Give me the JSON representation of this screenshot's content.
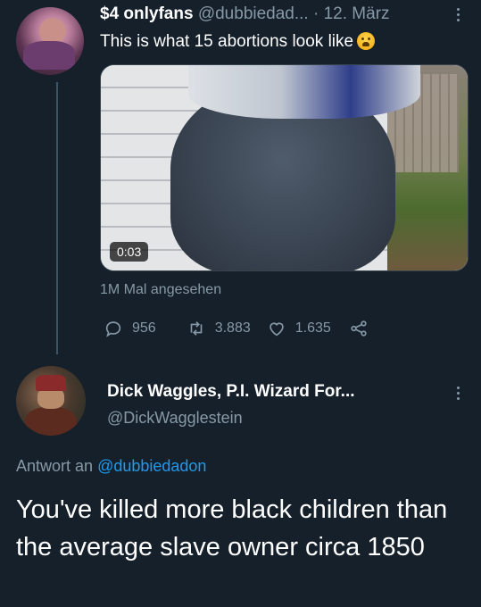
{
  "tweet": {
    "display_name": "$4 onlyfans",
    "handle": "@dubbiedad...",
    "separator": "·",
    "date": "12. März",
    "text": "This is what 15 abortions look like",
    "emoji": "crying-emoji",
    "video_time": "0:03",
    "views": "1M Mal angesehen",
    "replies": "956",
    "retweets": "3.883",
    "likes": "1.635"
  },
  "reply": {
    "display_name": "Dick Waggles, P.I. Wizard For...",
    "handle": "@DickWagglestein",
    "replying_to_prefix": "Antwort an",
    "replying_to_handle": "@dubbiedadon",
    "text": "You've killed more black children than the average slave owner circa 1850"
  },
  "colors": {
    "background": "#15202b",
    "muted": "#8899a6",
    "accent": "#1d9bf0",
    "thread_line": "#3d5466"
  }
}
